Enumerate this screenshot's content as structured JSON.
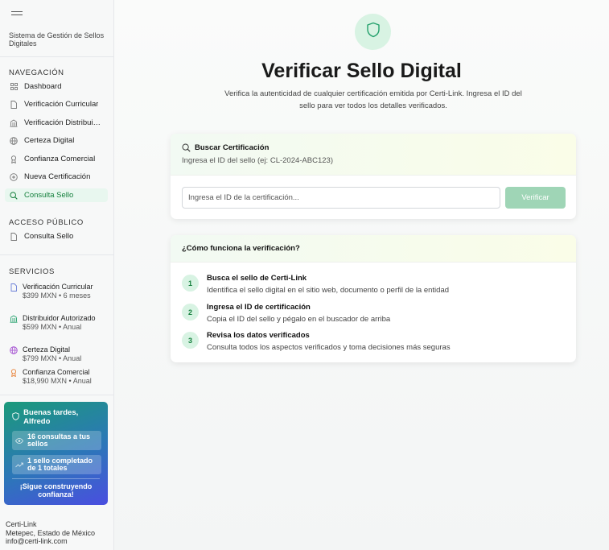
{
  "sidebar": {
    "subtitle": "Sistema de Gestión de Sellos Digitales",
    "nav_title": "NAVEGACIÓN",
    "nav_items": [
      {
        "label": "Dashboard",
        "icon": "grid-icon"
      },
      {
        "label": "Verificación Curricular",
        "icon": "document-icon"
      },
      {
        "label": "Verificación Distribuidor",
        "icon": "building-icon"
      },
      {
        "label": "Certeza Digital",
        "icon": "globe-icon"
      },
      {
        "label": "Confianza Comercial",
        "icon": "award-icon"
      },
      {
        "label": "Nueva Certificación",
        "icon": "plus-circle-icon"
      },
      {
        "label": "Consulta Sello",
        "icon": "search-icon",
        "active": true
      }
    ],
    "public_title": "ACCESO PÚBLICO",
    "public_items": [
      {
        "label": "Consulta Sello",
        "icon": "document-icon"
      }
    ],
    "services_title": "SERVICIOS",
    "services": [
      {
        "name": "Verificación Curricular",
        "price": "$399 MXN • 6 meses",
        "color": "#6b7fd7"
      },
      {
        "name": "Distribuidor Autorizado",
        "price": "$599 MXN • Anual",
        "color": "#22a06b"
      },
      {
        "name": "Certeza Digital",
        "price": "$799 MXN • Anual",
        "color": "#a24bd0"
      },
      {
        "name": "Confianza Comercial",
        "price": "$18,990 MXN • Anual",
        "color": "#e8833a"
      }
    ],
    "greeting": {
      "title": "Buenas tardes, Alfredo",
      "stat1": "16 consultas a tus sellos",
      "stat2": "1 sello completado de 1 totales",
      "footer": "¡Sigue construyendo confianza!"
    },
    "footer": {
      "company": "Certi-Link",
      "location": "Metepec, Estado de México",
      "email": "info@certi-link.com"
    }
  },
  "main": {
    "title": "Verificar Sello Digital",
    "description": "Verifica la autenticidad de cualquier certificación emitida por Certi-Link. Ingresa el ID del sello para ver todos los detalles verificados.",
    "search": {
      "title": "Buscar Certificación",
      "subtitle": "Ingresa el ID del sello (ej: CL-2024-ABC123)",
      "placeholder": "Ingresa el ID de la certificación...",
      "button": "Verificar"
    },
    "how": {
      "title": "¿Cómo funciona la verificación?",
      "steps": [
        {
          "num": "1",
          "title": "Busca el sello de Certi-Link",
          "desc": "Identifica el sello digital en el sitio web, documento o perfil de la entidad"
        },
        {
          "num": "2",
          "title": "Ingresa el ID de certificación",
          "desc": "Copia el ID del sello y pégalo en el buscador de arriba"
        },
        {
          "num": "3",
          "title": "Revisa los datos verificados",
          "desc": "Consulta todos los aspectos verificados y toma decisiones más seguras"
        }
      ]
    }
  },
  "colors": {
    "accent": "#15803d",
    "accent_light": "#d8f3e3",
    "button_disabled": "#9fd5b6"
  }
}
